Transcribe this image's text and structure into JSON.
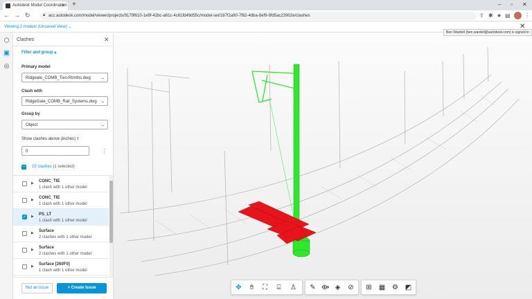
{
  "browser": {
    "tab_title": "Autodesk Model Coordination",
    "url": "acc.autodesk.com/model/viewer/projects/9179f610-1e9f-42bc-a61c-4c61fd49d55c/model-set/187f2a90-7f82-4dba-8ef9-9fd5ac23902e/clashes"
  },
  "appbar": {
    "viewing_label": "Viewing 2 models (Unsaved View) ⌄",
    "tooltip": "Ben Wardell (ben.wardell@autodesk.com) is signed in"
  },
  "panel": {
    "title": "Clashes",
    "filter_toggle": "Filter and group ▴",
    "primary_model_label": "Primary model",
    "primary_model_value": "Ridgeate_COMB_Ties-Rtrnths.dwg",
    "clash_with_label": "Clash with",
    "clash_with_value": "RidgeGate_COMB_Rail_Systems.dwg",
    "group_by_label": "Group by",
    "group_by_value": "Object",
    "threshold_label": "Show clashes above (inches)",
    "threshold_value": "0",
    "clash_count": "15 clashes",
    "clash_selected": "(1 selected)",
    "items": [
      {
        "name": "CONC_TIE",
        "desc": "1 clash with 1 other model",
        "selected": false
      },
      {
        "name": "CONC_TIE",
        "desc": "1 clash with 1 other model",
        "selected": false
      },
      {
        "name": "PS_LT",
        "desc": "1 clash with 1 other model",
        "selected": true
      },
      {
        "name": "Surface",
        "desc": "2 clashes with 1 other model",
        "selected": false
      },
      {
        "name": "Surface",
        "desc": "2 clashes with 1 other model",
        "selected": false
      },
      {
        "name": "Surface [260F0]",
        "desc": "1 clash with 1 other model",
        "selected": false
      }
    ],
    "not_issue_label": "Not an issue",
    "create_issue_label": "+ Create Issue"
  },
  "colors": {
    "accent": "#0696d7",
    "clash_primary": "#2ee82e",
    "clash_secondary": "#e8141b"
  },
  "icons": {
    "rail": [
      "cube-icon",
      "clash-icon",
      "check-circle-icon"
    ],
    "toolbar": [
      "orbit-icon",
      "pan-icon",
      "fit-icon",
      "camera-icon",
      "person-icon",
      "measure-icon",
      "section-icon",
      "layers-icon",
      "visibility-icon",
      "model-browser-icon",
      "properties-icon",
      "settings-icon",
      "fullscreen-icon"
    ]
  }
}
